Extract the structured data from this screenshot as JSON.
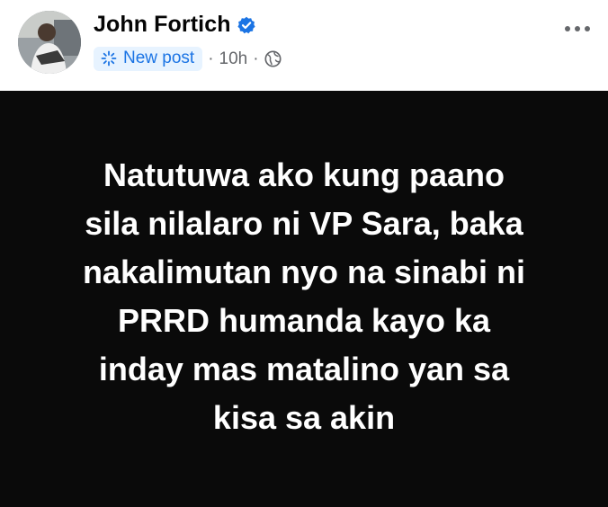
{
  "post": {
    "author": "John Fortich",
    "badge_label": "New post",
    "separator": "·",
    "timestamp": "10h",
    "audience_icon": "globe-icon",
    "verified_icon": "verified-badge-icon",
    "more_icon": "more-horizontal-icon",
    "text_lines": [
      "Natutuwa ako kung paano",
      "sila nilalaro ni VP Sara, baka",
      "nakalimutan nyo na sinabi ni",
      "PRRD humanda kayo ka",
      "inday mas matalino yan sa",
      "kisa sa akin"
    ]
  },
  "colors": {
    "brand_blue": "#1b74e4",
    "badge_bg": "#e7f3ff",
    "card_bg": "#0a0a0a",
    "text_secondary": "#65676b"
  }
}
